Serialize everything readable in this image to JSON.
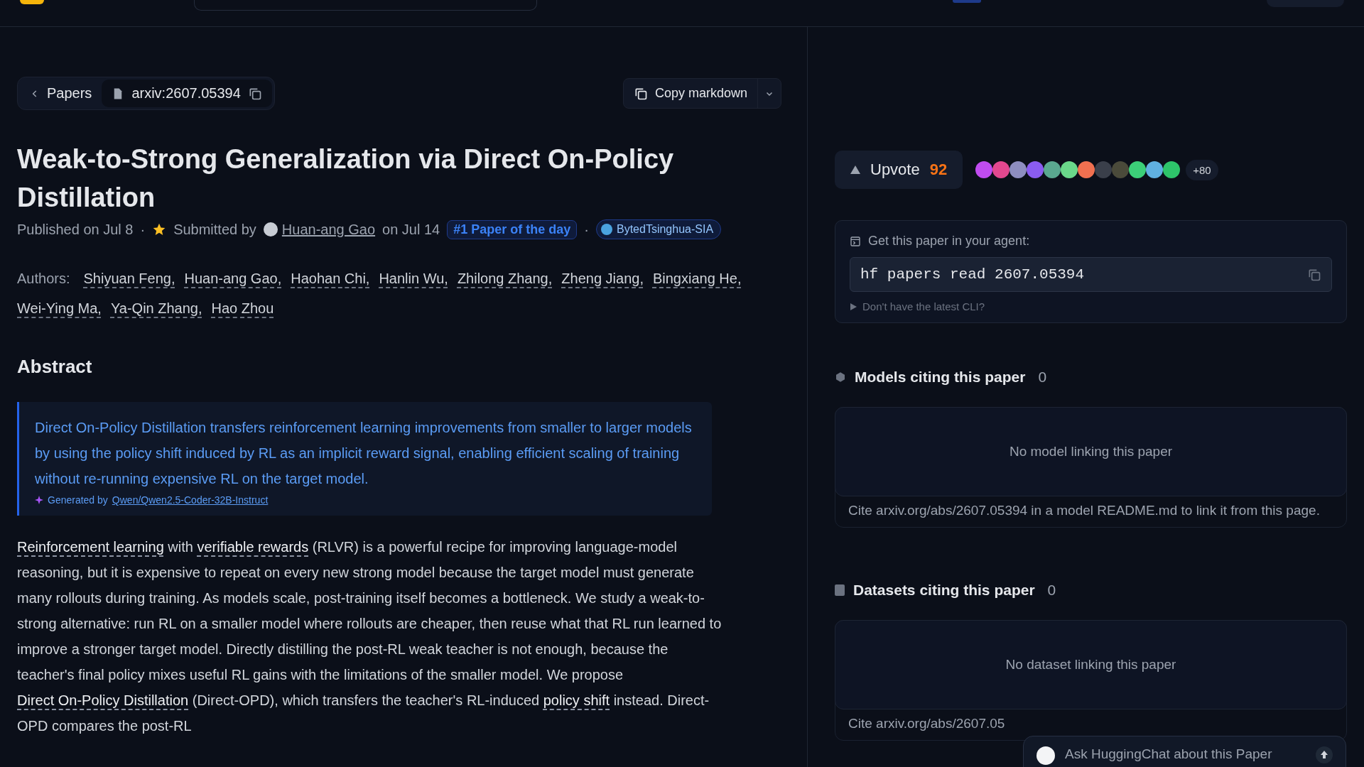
{
  "breadcrumb": {
    "back": "Papers",
    "paper_id": "arxiv:2607.05394"
  },
  "copy_markdown": "Copy markdown",
  "title": "Weak-to-Strong Generalization via Direct On-Policy Distillation",
  "meta": {
    "published": "Published on Jul 8",
    "separator": "·",
    "submitted_by": "Submitted by",
    "submitter": "Huan-ang Gao",
    "submitted_on": "on Jul 14",
    "badge": "#1 Paper of the day",
    "organization": "BytedTsinghua-SIA"
  },
  "authors_label": "Authors:",
  "authors": [
    "Shiyuan Feng,",
    "Huan-ang Gao,",
    "Haohan Chi,",
    "Hanlin Wu,",
    "Zhilong Zhang,",
    "Zheng Jiang,",
    "Bingxiang He,",
    "Wei-Ying Ma,",
    "Ya-Qin Zhang,",
    "Hao Zhou"
  ],
  "abstract": {
    "heading": "Abstract",
    "summary": "Direct On-Policy Distillation transfers reinforcement learning improvements from smaller to larger models by using the policy shift induced by RL as an implicit reward signal, enabling efficient scaling of training without re-running expensive RL on the target model.",
    "generated_by": "Generated by",
    "model": "Qwen/Qwen2.5-Coder-32B-Instruct",
    "body": [
      {
        "text": "Reinforcement learning",
        "link": true
      },
      {
        "text": " with ",
        "link": false
      },
      {
        "text": "verifiable rewards",
        "link": true
      },
      {
        "text": " (RLVR) is a powerful recipe for improving language-model reasoning, but it is expensive to repeat on every new strong model because the target model must generate many rollouts during training. As models scale, post-training itself becomes a bottleneck. We study a weak-to-strong alternative: run RL on a smaller model where rollouts are cheaper, then reuse what that RL run learned to improve a stronger target model. Directly distilling the post-RL weak teacher is not enough, because the teacher's final policy mixes useful RL gains with the limitations of the smaller model. We propose ",
        "link": false
      },
      {
        "text": "Direct On-Policy Distillation",
        "link": true
      },
      {
        "text": " (Direct-OPD), which transfers the teacher's RL-induced ",
        "link": false
      },
      {
        "text": "policy shift",
        "link": true
      },
      {
        "text": " instead. Direct-OPD compares the post-RL",
        "link": false
      }
    ]
  },
  "upvote": {
    "label": "Upvote",
    "count": "92"
  },
  "avatars": [
    {
      "color": "#c04cf0"
    },
    {
      "color": "#e2488f"
    },
    {
      "color": "#8e8ec0"
    },
    {
      "color": "#8a5cf0"
    },
    {
      "color": "#5aa890"
    },
    {
      "color": "#6ad88a"
    },
    {
      "color": "#f07050"
    },
    {
      "color": "#3a3f4a"
    },
    {
      "color": "#4a4a3a"
    },
    {
      "color": "#3ccf78"
    },
    {
      "color": "#60b0e0"
    },
    {
      "color": "#2ec46a"
    }
  ],
  "more_voters": "+80",
  "agent": {
    "label": "Get this paper in your agent:",
    "command": "hf papers read 2607.05394",
    "cli_hint": "Don't have the latest CLI?",
    "cli_expanded": false
  },
  "citing": [
    {
      "kind": "models",
      "title": "Models citing this paper",
      "count": "0",
      "empty": "No model linking this paper",
      "hint": "Cite arxiv.org/abs/2607.05394 in a model README.md to link it from this page."
    },
    {
      "kind": "datasets",
      "title": "Datasets citing this paper",
      "count": "0",
      "empty": "No dataset linking this paper",
      "hint": "Cite arxiv.org/abs/2607.05"
    }
  ],
  "chat": {
    "label": "Ask HuggingChat about this Paper"
  }
}
